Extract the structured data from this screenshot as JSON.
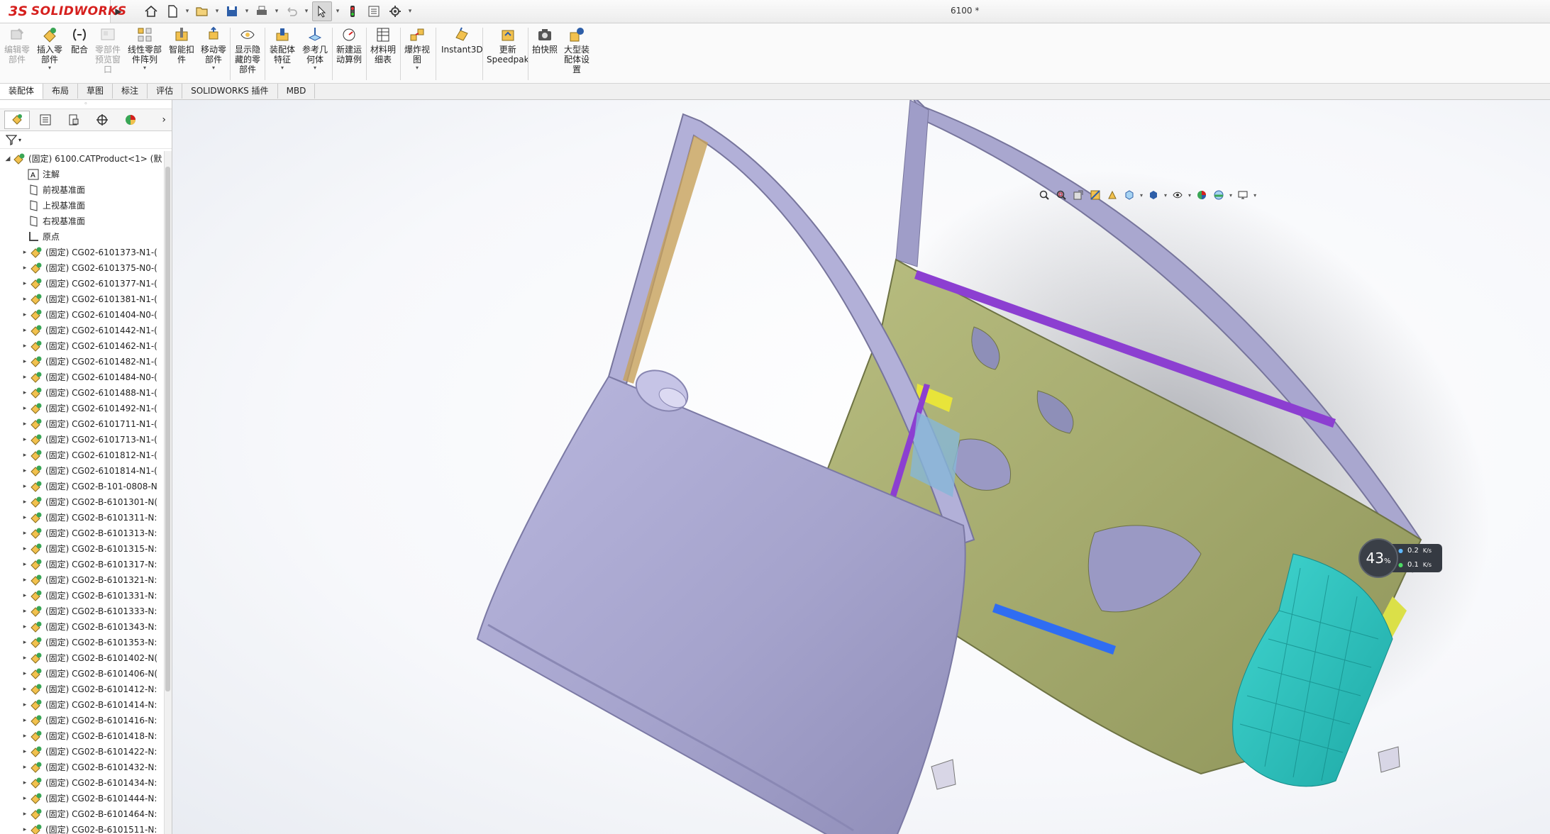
{
  "app": {
    "brand_ds": "3S",
    "brand_name": "SOLIDWORKS",
    "document_title": "6100 *"
  },
  "colors": {
    "brand_red": "#d6201e",
    "door_purple": "#a9a7cf",
    "frame_olive": "#a7ad6e",
    "cyan_mesh": "#2bc7c2"
  },
  "quickbar": {
    "items": [
      "home-icon",
      "new-document-icon",
      "open-icon",
      "save-icon",
      "print-icon",
      "undo-icon",
      "select-icon",
      "traffic-light-icon",
      "file-properties-icon",
      "options-icon"
    ]
  },
  "ribbon": {
    "buttons": [
      {
        "label": "编辑零\n部件",
        "icon": "edit-component-icon",
        "disabled": true,
        "dropdown": false
      },
      {
        "label": "插入零\n部件",
        "icon": "insert-component-icon",
        "disabled": false,
        "dropdown": true
      },
      {
        "label": "配合",
        "icon": "mate-icon",
        "disabled": false,
        "dropdown": false
      },
      {
        "label": "零部件\n预览窗\n口",
        "icon": "component-preview-icon",
        "disabled": true,
        "dropdown": false
      },
      {
        "label": "线性零部\n件阵列",
        "icon": "linear-pattern-icon",
        "disabled": false,
        "dropdown": true
      },
      {
        "label": "智能扣\n件",
        "icon": "smart-fastener-icon",
        "disabled": false,
        "dropdown": false
      },
      {
        "label": "移动零\n部件",
        "icon": "move-component-icon",
        "disabled": false,
        "dropdown": true
      },
      {
        "label": "显示隐\n藏的零\n部件",
        "icon": "show-hidden-icon",
        "disabled": false,
        "dropdown": false
      },
      {
        "label": "装配体\n特征",
        "icon": "assembly-feature-icon",
        "disabled": false,
        "dropdown": true
      },
      {
        "label": "参考几\n何体",
        "icon": "reference-geometry-icon",
        "disabled": false,
        "dropdown": true
      },
      {
        "label": "新建运\n动算例",
        "icon": "motion-study-icon",
        "disabled": false,
        "dropdown": false
      },
      {
        "label": "材料明\n细表",
        "icon": "bom-icon",
        "disabled": false,
        "dropdown": false
      },
      {
        "label": "爆炸视\n图",
        "icon": "exploded-view-icon",
        "disabled": false,
        "dropdown": true
      },
      {
        "label": "Instant3D",
        "icon": "instant3d-icon",
        "disabled": false,
        "dropdown": false
      },
      {
        "label": "更新\nSpeedpak",
        "icon": "speedpak-icon",
        "disabled": false,
        "dropdown": false
      },
      {
        "label": "拍快照",
        "icon": "snapshot-icon",
        "disabled": false,
        "dropdown": false
      },
      {
        "label": "大型装\n配体设\n置",
        "icon": "large-assembly-icon",
        "disabled": false,
        "dropdown": false
      }
    ]
  },
  "tabs": [
    "装配体",
    "布局",
    "草图",
    "标注",
    "评估",
    "SOLIDWORKS 插件",
    "MBD"
  ],
  "active_tab": "装配体",
  "tree": {
    "root": "(固定) 6100.CATProduct<1> (默",
    "fixed_items": [
      {
        "label": "注解",
        "icon": "annotation-icon"
      },
      {
        "label": "前视基准面",
        "icon": "plane-icon"
      },
      {
        "label": "上视基准面",
        "icon": "plane-icon"
      },
      {
        "label": "右视基准面",
        "icon": "plane-icon"
      },
      {
        "label": "原点",
        "icon": "origin-icon"
      }
    ],
    "components": [
      "(固定) CG02-6101373-N1-(",
      "(固定) CG02-6101375-N0-(",
      "(固定) CG02-6101377-N1-(",
      "(固定) CG02-6101381-N1-(",
      "(固定) CG02-6101404-N0-(",
      "(固定) CG02-6101442-N1-(",
      "(固定) CG02-6101462-N1-(",
      "(固定) CG02-6101482-N1-(",
      "(固定) CG02-6101484-N0-(",
      "(固定) CG02-6101488-N1-(",
      "(固定) CG02-6101492-N1-(",
      "(固定) CG02-6101711-N1-(",
      "(固定) CG02-6101713-N1-(",
      "(固定) CG02-6101812-N1-(",
      "(固定) CG02-6101814-N1-(",
      "(固定) CG02-B-101-0808-N",
      "(固定) CG02-B-6101301-N(",
      "(固定) CG02-B-6101311-N:",
      "(固定) CG02-B-6101313-N:",
      "(固定) CG02-B-6101315-N:",
      "(固定) CG02-B-6101317-N:",
      "(固定) CG02-B-6101321-N:",
      "(固定) CG02-B-6101331-N:",
      "(固定) CG02-B-6101333-N:",
      "(固定) CG02-B-6101343-N:",
      "(固定) CG02-B-6101353-N:",
      "(固定) CG02-B-6101402-N(",
      "(固定) CG02-B-6101406-N(",
      "(固定) CG02-B-6101412-N:",
      "(固定) CG02-B-6101414-N:",
      "(固定) CG02-B-6101416-N:",
      "(固定) CG02-B-6101418-N:",
      "(固定) CG02-B-6101422-N:",
      "(固定) CG02-B-6101432-N:",
      "(固定) CG02-B-6101434-N:",
      "(固定) CG02-B-6101444-N:",
      "(固定) CG02-B-6101464-N:",
      "(固定) CG02-B-6101511-N:"
    ]
  },
  "viewport": {
    "headsup_icons": [
      "zoom-to-fit-icon",
      "zoom-area-icon",
      "previous-view-icon",
      "section-view-icon",
      "dynamic-annotation-icon",
      "view-orientation-icon",
      "display-style-icon",
      "hide-show-icon",
      "edit-appearance-icon",
      "apply-scene-icon",
      "view-settings-icon"
    ],
    "speed_widget": {
      "percent": "43",
      "percent_symbol": "%",
      "upload": "0.2",
      "download": "0.1",
      "unit": "K/s"
    }
  }
}
